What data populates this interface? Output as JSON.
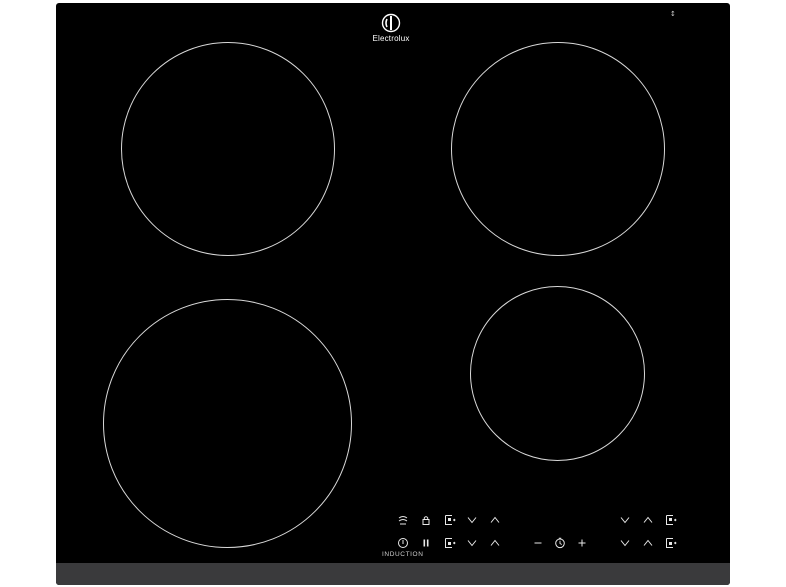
{
  "brand": {
    "name": "Electrolux",
    "logo_icon": "electrolux-logo-icon"
  },
  "corner_mark": "↕",
  "panel": {
    "label": "INDUCTION"
  },
  "zones": [
    {
      "id": "rear-left"
    },
    {
      "id": "rear-right"
    },
    {
      "id": "front-left"
    },
    {
      "id": "front-right"
    }
  ],
  "controls": {
    "top_row": [
      "bridge-icon",
      "lock-icon",
      "timer-zone-icon",
      "chevron-down-icon",
      "chevron-up-icon",
      "chevron-down-icon",
      "chevron-up-icon",
      "timer-zone-icon"
    ],
    "bottom_row": [
      "power-icon",
      "pause-icon",
      "timer-zone-icon",
      "chevron-down-icon",
      "chevron-up-icon",
      "minus-icon",
      "clock-icon",
      "plus-icon",
      "chevron-down-icon",
      "chevron-up-icon",
      "timer-zone-icon"
    ]
  },
  "colors": {
    "glass": "#000000",
    "trim": "#3a3a3c",
    "ring": "#d9d9d9",
    "symbol": "#e8e8e8"
  }
}
